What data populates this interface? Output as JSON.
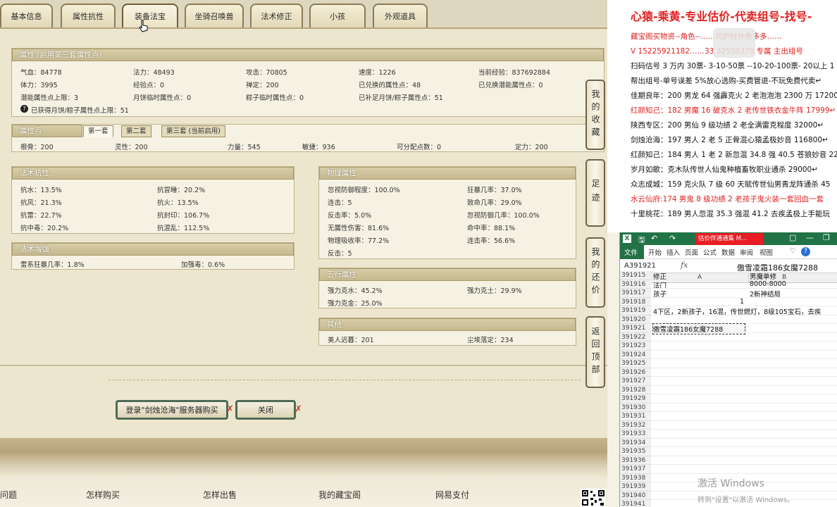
{
  "tabs": [
    "基本信息",
    "属性抗性",
    "装备法宝",
    "坐骑召唤兽",
    "法术修正",
    "小孩",
    "外观道具"
  ],
  "attr": {
    "header": "属性 (启用第三套属性点)",
    "rows": [
      [
        "气血：84778",
        "法力：48493",
        "攻击：70805",
        "速度：1226",
        "当前经验：837692884"
      ],
      [
        "体力：3995",
        "经验点：0",
        "禅定：200",
        "已兑换的属性点：48",
        "已兑换潜能属性点：0"
      ],
      [
        "潜能属性点上限：3",
        "月饼临时属性点：0",
        "粽子临时属性点：0",
        "已补足月饼/粽子属性点：51",
        ""
      ]
    ],
    "note": "已获得月饼/粽子属性点上限：51"
  },
  "points": {
    "header": "属性点",
    "subtabs": [
      "第一套",
      "第二套",
      "第三套 (当前启用)"
    ],
    "values": [
      "根骨：200",
      "灵性：200",
      "力量：545",
      "敏捷：936",
      "可分配点数：0",
      "定力：200"
    ]
  },
  "resist": {
    "header": "法术抗性",
    "rows": [
      [
        "抗水：13.5%",
        "抗冒睡：20.2%"
      ],
      [
        "抗风：21.3%",
        "抗火：13.5%"
      ],
      [
        "抗雷：22.7%",
        "抗封印：106.7%"
      ],
      [
        "抗中毒：20.2%",
        "抗混乱：112.5%"
      ]
    ]
  },
  "boost": {
    "header": "法术增强",
    "rows": [
      [
        "雷系狂暴几率：1.8%",
        "加强毒：0.6%"
      ]
    ]
  },
  "phys": {
    "header": "物理属性",
    "rows": [
      [
        "忽视防御程度：100.0%",
        "狂暴几率：37.0%"
      ],
      [
        "连击：5",
        "致命几率：29.0%"
      ],
      [
        "反击率：5.0%",
        "忽视防御几率：100.0%"
      ],
      [
        "无属性伤害：81.6%",
        "命中率：88.1%"
      ],
      [
        "物理吸收率：77.2%",
        "连击率：56.6%"
      ],
      [
        "反击：5",
        ""
      ]
    ]
  },
  "five": {
    "header": "五行属性",
    "rows": [
      [
        "强力克水：45.2%",
        "强力克土：29.9%"
      ],
      [
        "强力克金：25.0%",
        ""
      ]
    ]
  },
  "other": {
    "header": "其他",
    "rows": [
      [
        "美人迟暮：201",
        "尘埃落定：234"
      ]
    ]
  },
  "side": [
    "我的收藏",
    "足迹",
    "我的还价",
    "返回顶部"
  ],
  "actions": {
    "buy": "登录\"剑烛沧海\"服务器购买",
    "close": "关闭"
  },
  "footer": [
    "问题",
    "怎样购买",
    "怎样出售",
    "我的藏宝阁",
    "网易支付"
  ],
  "doc": {
    "title": "心猿-乘黄-专业估价-代卖组号-找号-",
    "lines": [
      {
        "t": "藏宝阁买物资--角色--……司护好外务多多……",
        "red": true
      },
      {
        "t": "V 15225921182……33 32559378 专属 主出组号",
        "red": true
      },
      {
        "t": "扫码估号 3 万内 30票- 3-10-50票 --10-20-100票- 20以上 1",
        "red": false
      },
      {
        "t": "帮出组号-单号误差 5%放心选购-买费管退-不玩免费代卖↵",
        "red": false
      },
      {
        "t": "佳期良年：200 男龙 64 强霹克火 2 老泡泡泡 2300 万 17200",
        "red": false
      },
      {
        "t": "红颜知己：182 男魔 16 破克水 2 老传世铁衣金牛阵 17999↵",
        "red": true
      },
      {
        "t": "陕西专区：200 男仙 9 级功绩 2 老全满雷克程度 32000↵",
        "red": false
      },
      {
        "t": "剑烛沧海：197 男人 2 老 5 正骨混心猿孟极妙音 116800↵",
        "red": false
      },
      {
        "t": "红颜知己：184 男人 1 老 2 新忽混 34.8 强 40.5 苍狼妙音 22",
        "red": false
      },
      {
        "t": "岁月如歌：克木队传世人仙鬼种植畜牧职业通杀 29000↵",
        "red": false
      },
      {
        "t": "众志成城：159 克火队 7 级 60 天赋传世仙男青龙阵通杀 45",
        "red": false
      },
      {
        "t": "水云仙府:174 男鬼 8 级功绩 2 老孩子鬼火装一套回血一套",
        "red": true
      },
      {
        "t": "十里桃花：189 男人忽混 35.3 强混 41.2 去疾孟极上手能玩",
        "red": false
      }
    ]
  },
  "excel": {
    "title": "估价伴通通集 M...",
    "ribbon": [
      "文件",
      "开始",
      "插入",
      "页面",
      "公式",
      "数据",
      "审阅",
      "视图"
    ],
    "namebox": "A391921",
    "formula": "傲雪凌霜186女魔7288",
    "cols": [
      "A",
      "B"
    ],
    "rows": [
      {
        "n": "391915",
        "a": "修正",
        "b": "男魔单修"
      },
      {
        "n": "391916",
        "a": "法门",
        "b": "8000-8000"
      },
      {
        "n": "391917",
        "a": "孩子",
        "b": "2新神结局"
      },
      {
        "n": "391918",
        "a": "1",
        "b": ""
      },
      {
        "n": "391919",
        "a": "4下区，2新孩子，16混，传世燃灯，8级105宝石，去疾",
        "b": ""
      },
      {
        "n": "391920",
        "a": "",
        "b": ""
      },
      {
        "n": "391921",
        "a": "傲雪凌霜186女魔7288",
        "b": ""
      },
      {
        "n": "391922",
        "a": "",
        "b": ""
      },
      {
        "n": "391923",
        "a": "",
        "b": ""
      },
      {
        "n": "391924",
        "a": "",
        "b": ""
      },
      {
        "n": "391925",
        "a": "",
        "b": ""
      },
      {
        "n": "391926",
        "a": "",
        "b": ""
      },
      {
        "n": "391927",
        "a": "",
        "b": ""
      },
      {
        "n": "391928",
        "a": "",
        "b": ""
      },
      {
        "n": "391929",
        "a": "",
        "b": ""
      },
      {
        "n": "391930",
        "a": "",
        "b": ""
      },
      {
        "n": "391931",
        "a": "",
        "b": ""
      },
      {
        "n": "391932",
        "a": "",
        "b": ""
      },
      {
        "n": "391933",
        "a": "",
        "b": ""
      },
      {
        "n": "391934",
        "a": "",
        "b": ""
      },
      {
        "n": "391935",
        "a": "",
        "b": ""
      },
      {
        "n": "391936",
        "a": "",
        "b": ""
      },
      {
        "n": "391937",
        "a": "",
        "b": ""
      },
      {
        "n": "391938",
        "a": "",
        "b": ""
      },
      {
        "n": "391939",
        "a": "",
        "b": ""
      },
      {
        "n": "391940",
        "a": "",
        "b": ""
      },
      {
        "n": "391941",
        "a": "",
        "b": ""
      }
    ],
    "watermark1": "激活 Windows",
    "watermark2": "转到\"设置\"以激活 Windows。"
  }
}
